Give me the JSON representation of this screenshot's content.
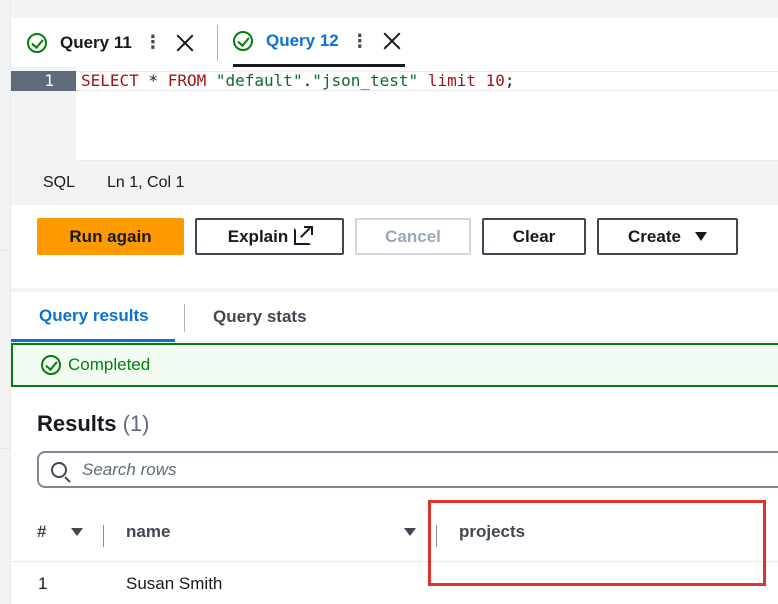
{
  "tabs": [
    {
      "label": "Query 11",
      "status": "completed",
      "active": false
    },
    {
      "label": "Query 12",
      "status": "completed",
      "active": true
    }
  ],
  "editor": {
    "line_number": "1",
    "code": {
      "kw1": "SELECT",
      "star": " * ",
      "kw2": "FROM",
      "sp": " ",
      "db": "\"default\"",
      "dot": ".",
      "table": "\"json_test\"",
      "sp2": " ",
      "kw3": "limit",
      "sp3": " ",
      "num": "10",
      "end": ";"
    }
  },
  "status_bar": {
    "language": "SQL",
    "position": "Ln 1, Col 1"
  },
  "actions": {
    "run_again": "Run again",
    "explain": "Explain",
    "cancel": "Cancel",
    "clear": "Clear",
    "create": "Create"
  },
  "results_tabs": {
    "query_results": "Query results",
    "query_stats": "Query stats"
  },
  "status_message": "Completed",
  "results": {
    "title": "Results",
    "count": "(1)",
    "search_placeholder": "Search rows",
    "columns": [
      "#",
      "name",
      "projects"
    ],
    "rows": [
      {
        "num": "1",
        "name": "Susan Smith",
        "projects": ""
      }
    ]
  },
  "colors": {
    "accent": "#0972d3",
    "primary_button": "#ff9900",
    "success": "#037f0c",
    "highlight": "#e0342a"
  }
}
